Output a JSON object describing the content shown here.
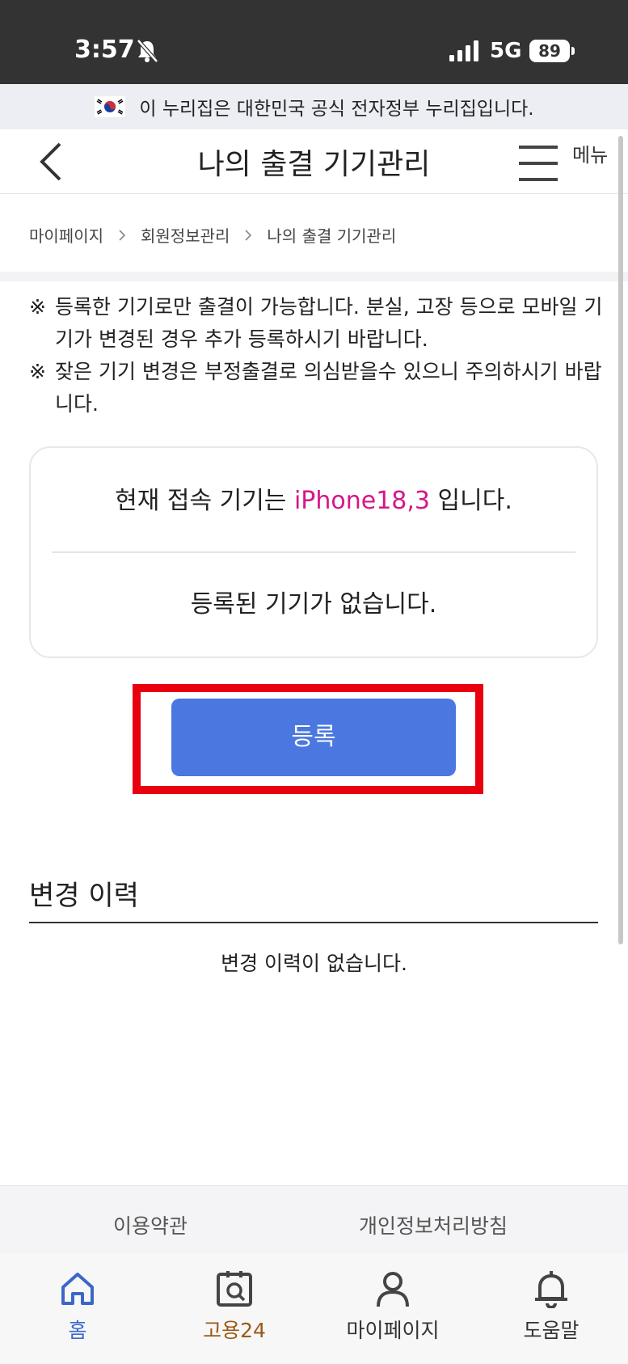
{
  "status_bar": {
    "time": "3:57",
    "network": "5G",
    "battery": "89"
  },
  "gov_banner": {
    "text": "이 누리집은 대한민국 공식 전자정부 누리집입니다."
  },
  "header": {
    "title": "나의 출결 기기관리",
    "menu_label": "메뉴"
  },
  "breadcrumb": {
    "items": [
      "마이페이지",
      "회원정보관리",
      "나의 출결 기기관리"
    ]
  },
  "notices": [
    {
      "mark": "※",
      "text": "등록한 기기로만 출결이 가능합니다. 분실, 고장 등으로 모바일 기기가 변경된 경우 추가 등록하시기 바랍니다."
    },
    {
      "mark": "※",
      "text": "잦은 기기 변경은 부정출결로 의심받을수 있으니 주의하시기 바랍니다."
    }
  ],
  "device_card": {
    "prefix": "현재 접속 기기는 ",
    "device_name": "iPhone18,3",
    "suffix": " 입니다.",
    "registered_status": "등록된 기기가 없습니다."
  },
  "register_button": {
    "label": "등록"
  },
  "history": {
    "title": "변경 이력",
    "empty_text": "변경 이력이 없습니다."
  },
  "footer": {
    "links": [
      "이용약관",
      "개인정보처리방침"
    ]
  },
  "bottom_nav": {
    "items": [
      {
        "label": "홈",
        "icon": "home-icon"
      },
      {
        "label": "고용24",
        "icon": "goyong24-icon"
      },
      {
        "label": "마이페이지",
        "icon": "person-icon"
      },
      {
        "label": "도움말",
        "icon": "bell-icon"
      }
    ]
  },
  "colors": {
    "accent": "#4a77e0",
    "device_highlight": "#d6168a",
    "annotation_box": "#e8000f",
    "home_active": "#3c67c9",
    "goyong_brand": "#9a5a15"
  }
}
